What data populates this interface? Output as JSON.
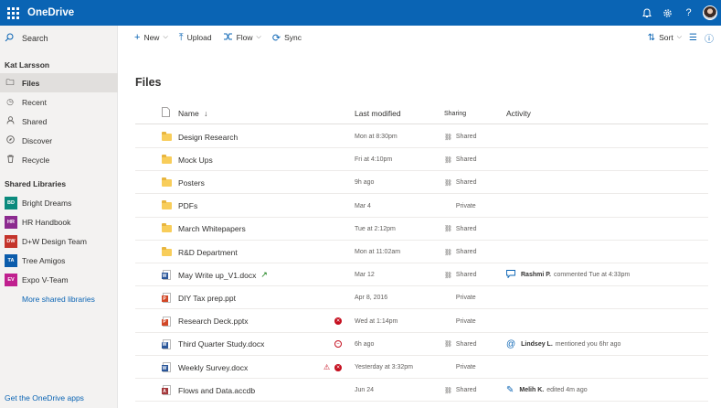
{
  "app": {
    "name": "OneDrive"
  },
  "sidebar": {
    "search_label": "Search",
    "user_name": "Kat Larsson",
    "nav": [
      {
        "label": "Files",
        "icon": "folder-icon"
      },
      {
        "label": "Recent",
        "icon": "clock-icon"
      },
      {
        "label": "Shared",
        "icon": "person-icon"
      },
      {
        "label": "Discover",
        "icon": "compass-icon"
      },
      {
        "label": "Recycle",
        "icon": "trash-icon"
      }
    ],
    "shared_libraries_title": "Shared Libraries",
    "libraries": [
      {
        "initials": "BD",
        "label": "Bright Dreams",
        "color": "#0b8a7d"
      },
      {
        "initials": "HR",
        "label": "HR Handbook",
        "color": "#8c2a8f"
      },
      {
        "initials": "DW",
        "label": "D+W Design Team",
        "color": "#c4342b"
      },
      {
        "initials": "TA",
        "label": "Tree Amigos",
        "color": "#0b5cab"
      },
      {
        "initials": "EV",
        "label": "Expo V-Team",
        "color": "#c0208f"
      }
    ],
    "more_libraries": "More shared libraries",
    "get_apps": "Get the OneDrive apps"
  },
  "toolbar": {
    "new_label": "New",
    "upload_label": "Upload",
    "flow_label": "Flow",
    "sync_label": "Sync",
    "sort_label": "Sort"
  },
  "main": {
    "title": "Files",
    "columns": {
      "name": "Name",
      "sort_arrow": "↓",
      "modified": "Last modified",
      "sharing": "Sharing",
      "activity": "Activity"
    },
    "rows": [
      {
        "type": "folder",
        "name": "Design Research",
        "modified": "Mon at 8:30pm",
        "sharing": "Shared",
        "activity_user": "",
        "activity_text": ""
      },
      {
        "type": "folder",
        "name": "Mock Ups",
        "modified": "Fri at 4:10pm",
        "sharing": "Shared",
        "activity_user": "",
        "activity_text": ""
      },
      {
        "type": "folder",
        "name": "Posters",
        "modified": "9h ago",
        "sharing": "Shared",
        "activity_user": "",
        "activity_text": ""
      },
      {
        "type": "folder",
        "name": "PDFs",
        "modified": "Mar 4",
        "sharing": "Private",
        "activity_user": "",
        "activity_text": ""
      },
      {
        "type": "folder",
        "name": "March Whitepapers",
        "modified": "Tue at 2:12pm",
        "sharing": "Shared",
        "activity_user": "",
        "activity_text": ""
      },
      {
        "type": "folder",
        "name": "R&D Department",
        "modified": "Mon at 11:02am",
        "sharing": "Shared",
        "activity_user": "",
        "activity_text": ""
      },
      {
        "type": "word",
        "name": "May Write up_V1.docx",
        "modified": "Mar 12",
        "sharing": "Shared",
        "activity_user": "Rashmi P.",
        "activity_text": "commented Tue at 4:33pm"
      },
      {
        "type": "ppt",
        "name": "DIY Tax prep.ppt",
        "modified": "Apr 8, 2016",
        "sharing": "Private",
        "activity_user": "",
        "activity_text": ""
      },
      {
        "type": "ppt",
        "name": "Research Deck.pptx",
        "modified": "Wed at 1:14pm",
        "sharing": "Private",
        "activity_user": "",
        "activity_text": ""
      },
      {
        "type": "word",
        "name": "Third Quarter Study.docx",
        "modified": "6h ago",
        "sharing": "Shared",
        "activity_user": "Lindsey L.",
        "activity_text": "mentioned you 6hr ago"
      },
      {
        "type": "word",
        "name": "Weekly Survey.docx",
        "modified": "Yesterday at 3:32pm",
        "sharing": "Private",
        "activity_user": "",
        "activity_text": ""
      },
      {
        "type": "access",
        "name": "Flows and Data.accdb",
        "modified": "Jun 24",
        "sharing": "Shared",
        "activity_user": "Melih K.",
        "activity_text": "edited 4m ago"
      }
    ]
  },
  "colors": {
    "brand": "#0a64b4",
    "word": "#2b579a",
    "ppt": "#d24726",
    "access": "#a4373a",
    "folder": "#f8cd5a"
  }
}
